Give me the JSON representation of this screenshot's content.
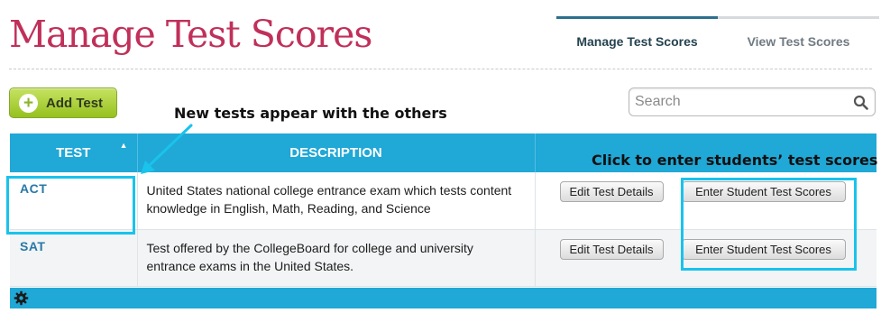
{
  "header": {
    "title": "Manage Test Scores",
    "tabs": [
      {
        "label": "Manage Test Scores",
        "active": true
      },
      {
        "label": "View Test Scores",
        "active": false
      }
    ]
  },
  "toolbar": {
    "add_label": "Add Test",
    "add_icon": "plus-circle-icon",
    "search_placeholder": "Search",
    "search_icon": "magnifier-icon"
  },
  "annotations": {
    "new_tests": "New tests appear with the others",
    "click_enter": "Click to enter students’ test scores"
  },
  "table": {
    "columns": [
      "TEST",
      "DESCRIPTION",
      ""
    ],
    "sort_indicator": "▲",
    "rows": [
      {
        "test": "ACT",
        "description": "United States national college entrance exam which tests content knowledge in English, Math, Reading, and Science",
        "edit_label": "Edit Test Details",
        "enter_label": "Enter Student Test Scores"
      },
      {
        "test": "SAT",
        "description": "Test offered by the CollegeBoard for college and university entrance exams in the United States.",
        "edit_label": "Edit Test Details",
        "enter_label": "Enter Student Test Scores"
      }
    ]
  },
  "footer": {
    "icon": "gear-icon"
  },
  "colors": {
    "brand_title": "#c0305a",
    "table_header": "#20a8d6",
    "highlight": "#19c3ec",
    "add_button": "#a8cc3a",
    "link": "#2679a6"
  }
}
